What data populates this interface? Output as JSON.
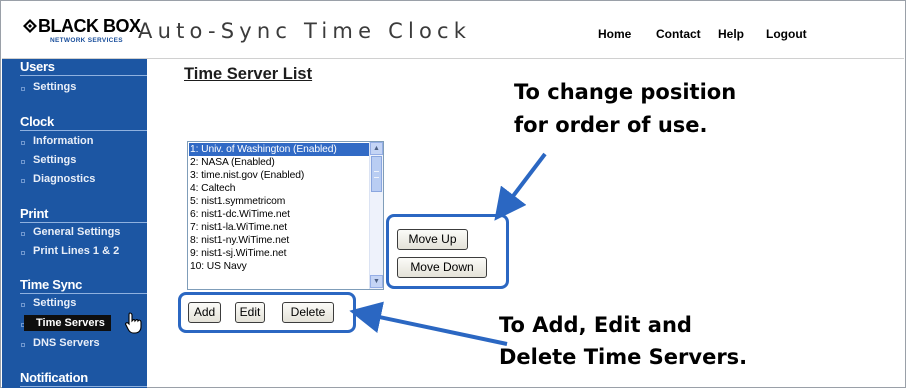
{
  "header": {
    "brand": "BLACK BOX",
    "brand_sub": "NETWORK SERVICES",
    "app_title": "Auto-Sync Time Clock",
    "nav": [
      "Home",
      "Contact",
      "Help",
      "Logout"
    ]
  },
  "sidebar": {
    "sections": [
      {
        "title": "Users",
        "items": [
          "Settings"
        ]
      },
      {
        "title": "Clock",
        "items": [
          "Information",
          "Settings",
          "Diagnostics"
        ]
      },
      {
        "title": "Print",
        "items": [
          "General Settings",
          "Print Lines 1 & 2"
        ]
      },
      {
        "title": "Time Sync",
        "items": [
          "Settings",
          "Time Servers",
          "DNS Servers"
        ]
      },
      {
        "title": "Notification",
        "items": []
      }
    ],
    "active_item": "Time Servers"
  },
  "main": {
    "page_title": "Time Server List",
    "servers": [
      "1: Univ. of Washington (Enabled)",
      "2: NASA (Enabled)",
      "3: time.nist.gov (Enabled)",
      "4: Caltech",
      "5: nist1.symmetricom",
      "6: nist1-dc.WiTime.net",
      "7: nist1-la.WiTime.net",
      "8: nist1-ny.WiTime.net",
      "9: nist1-sj.WiTime.net",
      "10: US Navy"
    ],
    "selected_server_index": 0,
    "buttons": {
      "move_up": "Move Up",
      "move_down": "Move Down",
      "add": "Add",
      "edit": "Edit",
      "delete": "Delete"
    }
  },
  "annotations": {
    "position_line1": "To change position",
    "position_line2": "for order of use.",
    "edit_line1": "To Add, Edit and",
    "edit_line2": "Delete Time Servers."
  },
  "colors": {
    "sidebar_bg": "#1c56a3",
    "highlight": "#2b67c2",
    "selection": "#316ac5"
  }
}
